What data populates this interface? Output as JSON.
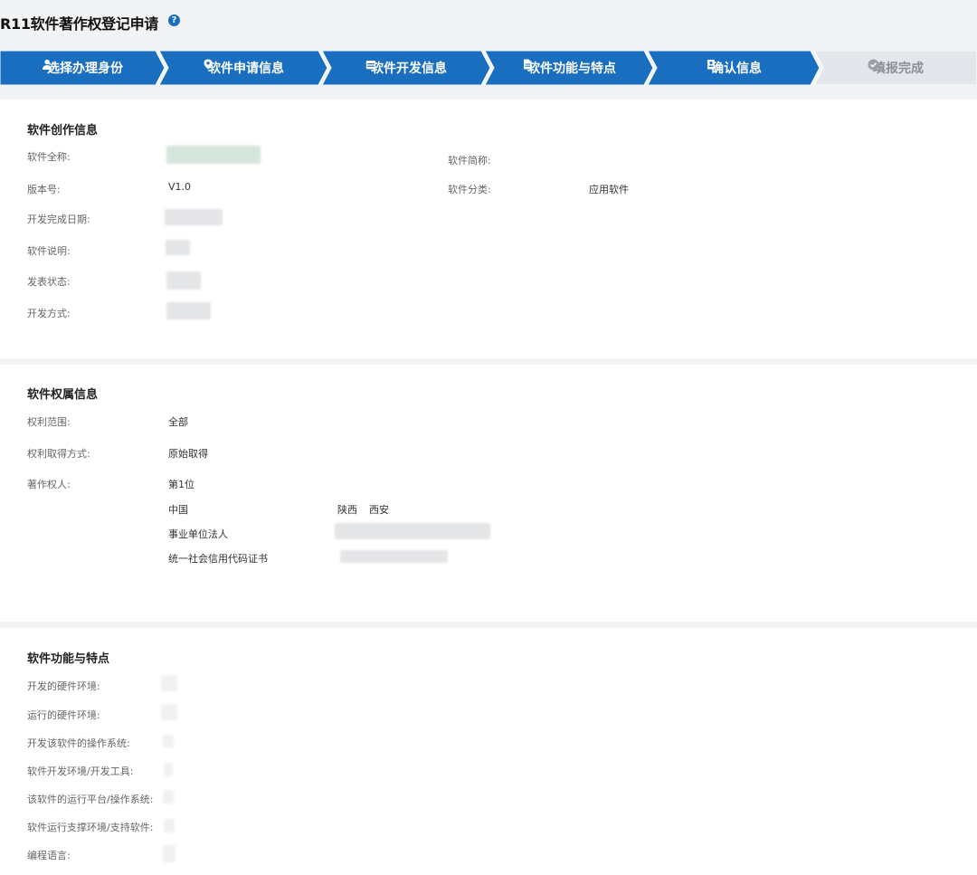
{
  "header": {
    "title": "R11软件著作权登记申请",
    "help_icon": "question-circle-icon"
  },
  "colors": {
    "step_active": "#1a6ec0",
    "step_inactive": "#e3e6ea",
    "page_bg": "#f2f3f5"
  },
  "stepper": {
    "steps": [
      {
        "label": "选择办理身份",
        "icon": "user-icon",
        "state": "active"
      },
      {
        "label": "软件申请信息",
        "icon": "location-pin-icon",
        "state": "active"
      },
      {
        "label": "软件开发信息",
        "icon": "calendar-icon",
        "state": "active"
      },
      {
        "label": "软件功能与特点",
        "icon": "document-icon",
        "state": "active"
      },
      {
        "label": "确认信息",
        "icon": "id-card-icon",
        "state": "active"
      },
      {
        "label": "填报完成",
        "icon": "check-circle-icon",
        "state": "pending"
      }
    ]
  },
  "creation": {
    "title": "软件创作信息",
    "full_name_label": "软件全称:",
    "short_name_label": "软件简称:",
    "version_label": "版本号:",
    "version_value": "V1.0",
    "category_label": "软件分类:",
    "category_value": "应用软件",
    "dev_date_label": "开发完成日期:",
    "description_label": "软件说明:",
    "publish_status_label": "发表状态:",
    "dev_method_label": "开发方式:"
  },
  "ownership": {
    "title": "软件权属信息",
    "scope_label": "权利范围:",
    "scope_value": "全部",
    "acquire_label": "权利取得方式:",
    "acquire_value": "原始取得",
    "holder_label": "著作权人:",
    "holder_index": "第1位",
    "country": "中国",
    "province": "陕西",
    "city": "西安",
    "entity_type": "事业单位法人",
    "cert_type": "统一社会信用代码证书"
  },
  "features": {
    "title": "软件功能与特点",
    "hw_dev_label": "开发的硬件环境:",
    "hw_run_label": "运行的硬件环境:",
    "os_dev_label": "开发该软件的操作系统:",
    "tools_label": "软件开发环境/开发工具:",
    "platform_label": "该软件的运行平台/操作系统:",
    "support_label": "软件运行支撑环境/支持软件:",
    "lang_label": "编程语言:"
  }
}
